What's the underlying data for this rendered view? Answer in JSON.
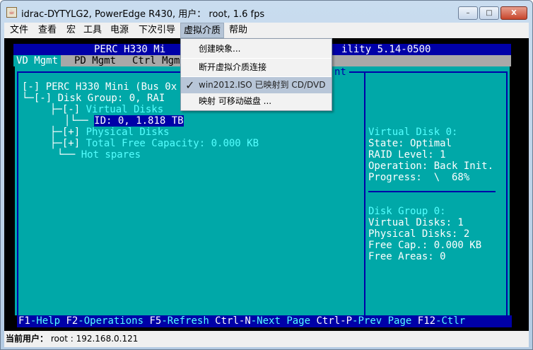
{
  "window": {
    "title": "idrac-DYTYLG2, PowerEdge R430, 用户： root, 1.6 fps",
    "minimize": "–",
    "maximize": "□",
    "close": "X"
  },
  "menubar": [
    "文件",
    "查看",
    "宏",
    "工具",
    "电源",
    "下次引导",
    "虚拟介质",
    "帮助"
  ],
  "dropdown": {
    "items": [
      {
        "label": "创建映象...",
        "checked": false
      },
      {
        "label": "断开虚拟介质连接",
        "checked": false
      },
      {
        "label": "win2012.ISO 已映射到 CD/DVD",
        "checked": true,
        "check_glyph": "✓"
      },
      {
        "label": "映射 可移动磁盘 ...",
        "checked": false
      }
    ]
  },
  "console": {
    "header_left": "PERC H330 Mi",
    "header_right": "ility 5.14-0500",
    "tabs": [
      "VD Mgmt",
      "PD Mgmt",
      "Ctrl Mgm"
    ],
    "panel_title_fragment": "nt",
    "tree": [
      {
        "text": "[-] PERC H330 Mini (Bus 0x",
        "style": "white"
      },
      {
        "text": "└─[-] Disk Group: 0, RAI",
        "style": "white"
      },
      {
        "prefix": "├─[-] ",
        "text": "Virtual Disks",
        "style": "cyan"
      },
      {
        "prefix": "│└── ",
        "text": "ID: 0, 1.818 TB",
        "style": "selected"
      },
      {
        "prefix": "├─[+] ",
        "text": "Physical Disks",
        "style": "cyan"
      },
      {
        "prefix": "├─[+] ",
        "text": "Total Free Capacity: 0.000 KB",
        "style": "cyan"
      },
      {
        "prefix": "└── ",
        "text": "Hot spares",
        "style": "cyan"
      }
    ],
    "vd_info": [
      "Virtual Disk 0:",
      "State: Optimal",
      "RAID Level: 1",
      "Operation: Back Init.",
      "Progress:  \\  68%"
    ],
    "dg_info": [
      "Disk Group 0:",
      "Virtual Disks: 1",
      "Physical Disks: 2",
      "Free Cap.: 0.000 KB",
      "Free Areas: 0"
    ],
    "progress_percent": 68,
    "footer": [
      [
        "F1",
        "-Help "
      ],
      [
        "F2",
        "-Operations "
      ],
      [
        "F5",
        "-Refresh "
      ],
      [
        "Ctrl-N",
        "-Next Page "
      ],
      [
        "Ctrl-P",
        "-Prev Page "
      ],
      [
        "F12",
        "-Ctlr"
      ]
    ]
  },
  "status": {
    "label": "当前用户：",
    "value": "root : 192.168.0.121"
  }
}
